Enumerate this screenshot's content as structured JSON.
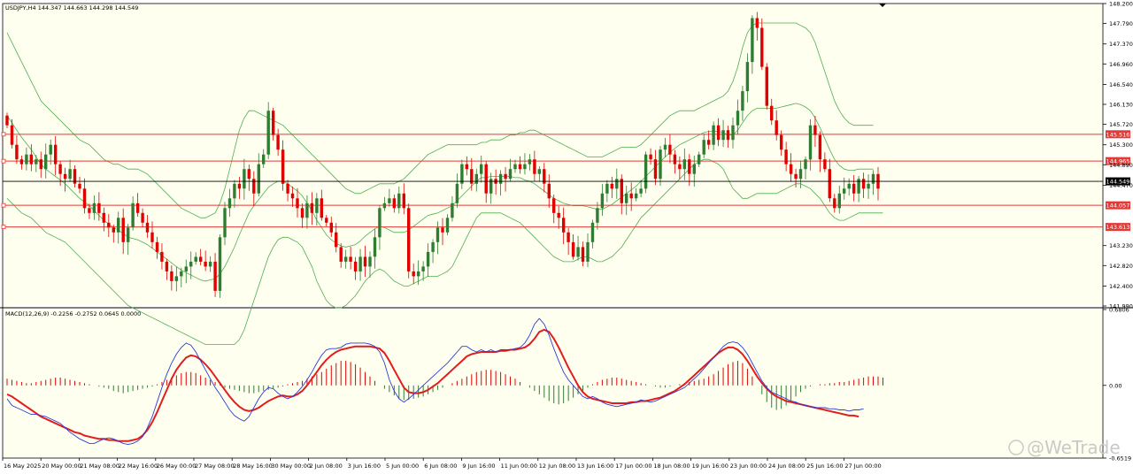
{
  "header": {
    "symbol_line": "USDJPY,H4  144.347 144.663 144.298 144.549",
    "macd_line": "MACD(12,26,9) -0.2256 -0.2752 0.0645 0.0000"
  },
  "watermark": "@WeTrade",
  "colors": {
    "background": "#fffff0",
    "bull": "#2e7d32",
    "bear": "#e00000",
    "bands": "#4caf50",
    "level": "#e53935",
    "macd": "#2d3bd6",
    "signal": "#e11d1d"
  },
  "chart_data": [
    {
      "type": "candlestick",
      "symbol": "USDJPY",
      "timeframe": "H4",
      "ylim": [
        141.99,
        148.2
      ],
      "y_ticks": [
        "148.200",
        "147.790",
        "147.370",
        "146.960",
        "146.540",
        "146.130",
        "145.720",
        "145.300",
        "144.890",
        "144.470",
        "142.820",
        "143.230",
        "142.400",
        "141.990"
      ],
      "x_ticks": [
        "16 May 2025",
        "20 May 00:00",
        "21 May 08:00",
        "22 May 16:00",
        "26 May 00:00",
        "27 May 08:00",
        "28 May 16:00",
        "30 May 00:00",
        "2 Jun 08:00",
        "3 Jun 16:00",
        "5 Jun 00:00",
        "6 Jun 08:00",
        "9 Jun 16:00",
        "11 Jun 00:00",
        "12 Jun 08:00",
        "13 Jun 16:00",
        "17 Jun 00:00",
        "18 Jun 08:00",
        "19 Jun 16:00",
        "23 Jun 00:00",
        "24 Jun 08:00",
        "25 Jun 16:00",
        "27 Jun 00:00"
      ],
      "current_price": "144.549",
      "levels": [
        {
          "label": "145.516",
          "value": 145.516
        },
        {
          "label": "144.965",
          "value": 144.965
        },
        {
          "label": "144.057",
          "value": 144.057
        },
        {
          "label": "143.613",
          "value": 143.613
        }
      ],
      "closes": [
        145.7,
        145.3,
        145.0,
        144.9,
        145.1,
        144.9,
        145.0,
        144.8,
        145.1,
        145.3,
        144.9,
        144.7,
        144.6,
        144.8,
        144.5,
        144.4,
        144.0,
        143.9,
        144.1,
        143.9,
        143.7,
        143.6,
        143.5,
        143.8,
        143.3,
        143.6,
        144.1,
        143.9,
        143.7,
        143.5,
        143.3,
        143.1,
        142.9,
        142.7,
        142.5,
        142.6,
        142.7,
        142.8,
        142.9,
        143.0,
        142.9,
        142.8,
        142.9,
        142.3,
        143.4,
        144.0,
        144.2,
        144.5,
        144.4,
        144.8,
        144.6,
        144.3,
        144.9,
        145.1,
        146.0,
        145.5,
        145.2,
        144.5,
        144.3,
        144.2,
        144.0,
        143.8,
        144.1,
        143.9,
        144.2,
        143.8,
        143.7,
        143.5,
        143.2,
        142.9,
        143.0,
        142.9,
        142.7,
        143.0,
        142.8,
        143.0,
        143.4,
        144.0,
        144.1,
        144.2,
        144.0,
        144.3,
        144.0,
        142.7,
        142.6,
        142.7,
        142.8,
        143.1,
        143.3,
        143.6,
        143.5,
        143.8,
        144.1,
        144.5,
        144.9,
        144.8,
        144.5,
        144.7,
        144.9,
        144.3,
        144.6,
        144.5,
        144.7,
        144.6,
        144.8,
        144.9,
        144.8,
        144.9,
        145.0,
        144.7,
        144.8,
        144.5,
        144.2,
        143.9,
        143.8,
        143.5,
        143.3,
        143.0,
        143.2,
        142.9,
        143.3,
        143.7,
        144.0,
        144.3,
        144.5,
        144.4,
        144.6,
        144.1,
        144.3,
        144.2,
        144.3,
        144.4,
        145.1,
        145.0,
        144.6,
        145.2,
        145.3,
        145.1,
        144.9,
        144.8,
        145.0,
        144.7,
        144.9,
        145.1,
        145.4,
        145.3,
        145.7,
        145.4,
        145.6,
        145.4,
        145.7,
        146.0,
        146.4,
        147.0,
        147.9,
        147.7,
        146.9,
        146.1,
        145.8,
        145.5,
        145.2,
        144.9,
        144.7,
        144.6,
        144.8,
        145.0,
        145.7,
        145.5,
        145.0,
        144.8,
        144.2,
        144.0,
        144.3,
        144.4,
        144.5,
        144.3,
        144.6,
        144.4,
        144.5,
        144.7,
        144.4
      ],
      "upper_band": [
        147.6,
        147.4,
        147.2,
        147.0,
        146.8,
        146.6,
        146.4,
        146.2,
        146.1,
        146.0,
        145.9,
        145.8,
        145.7,
        145.6,
        145.5,
        145.4,
        145.35,
        145.3,
        145.2,
        145.1,
        145.0,
        144.95,
        144.9,
        144.9,
        144.85,
        144.8,
        144.8,
        144.8,
        144.75,
        144.7,
        144.6,
        144.5,
        144.4,
        144.3,
        144.2,
        144.1,
        144.0,
        143.95,
        143.9,
        143.85,
        143.8,
        143.8,
        143.85,
        143.9,
        144.1,
        144.4,
        144.8,
        145.2,
        145.6,
        145.85,
        146.0,
        146.0,
        145.95,
        145.9,
        145.85,
        145.8,
        145.75,
        145.7,
        145.6,
        145.5,
        145.4,
        145.3,
        145.2,
        145.1,
        145.0,
        144.9,
        144.8,
        144.7,
        144.6,
        144.5,
        144.4,
        144.35,
        144.3,
        144.3,
        144.35,
        144.4,
        144.45,
        144.5,
        144.5,
        144.5,
        144.5,
        144.55,
        144.6,
        144.7,
        144.8,
        144.9,
        145.0,
        145.1,
        145.15,
        145.2,
        145.25,
        145.3,
        145.3,
        145.3,
        145.3,
        145.3,
        145.3,
        145.3,
        145.35,
        145.35,
        145.4,
        145.4,
        145.4,
        145.45,
        145.5,
        145.5,
        145.55,
        145.55,
        145.6,
        145.6,
        145.55,
        145.5,
        145.45,
        145.4,
        145.35,
        145.3,
        145.25,
        145.2,
        145.15,
        145.1,
        145.05,
        145.05,
        145.05,
        145.05,
        145.1,
        145.15,
        145.2,
        145.25,
        145.25,
        145.25,
        145.25,
        145.3,
        145.4,
        145.5,
        145.6,
        145.7,
        145.8,
        145.9,
        145.95,
        146.0,
        146.0,
        146.0,
        146.0,
        146.05,
        146.1,
        146.15,
        146.2,
        146.25,
        146.3,
        146.4,
        146.6,
        146.9,
        147.3,
        147.6,
        147.75,
        147.8,
        147.8,
        147.8,
        147.8,
        147.8,
        147.8,
        147.8,
        147.8,
        147.8,
        147.75,
        147.7,
        147.6,
        147.4,
        147.1,
        146.8,
        146.5,
        146.2,
        146.0,
        145.85,
        145.75,
        145.7,
        145.7,
        145.7,
        145.7,
        145.7
      ],
      "lower_band": [
        144.2,
        144.1,
        144.0,
        143.9,
        143.85,
        143.8,
        143.7,
        143.6,
        143.5,
        143.45,
        143.4,
        143.35,
        143.3,
        143.2,
        143.1,
        143.0,
        142.9,
        142.8,
        142.7,
        142.6,
        142.5,
        142.4,
        142.3,
        142.2,
        142.1,
        142.0,
        141.95,
        141.9,
        141.85,
        141.8,
        141.75,
        141.7,
        141.65,
        141.6,
        141.55,
        141.5,
        141.45,
        141.4,
        141.35,
        141.3,
        141.25,
        141.2,
        141.2,
        141.2,
        141.2,
        141.2,
        141.2,
        141.2,
        141.3,
        141.5,
        141.8,
        142.1,
        142.4,
        142.7,
        143.0,
        143.2,
        143.35,
        143.4,
        143.4,
        143.35,
        143.3,
        143.2,
        143.0,
        142.8,
        142.5,
        142.3,
        142.1,
        142.0,
        141.95,
        141.95,
        142.0,
        142.1,
        142.2,
        142.35,
        142.5,
        142.6,
        142.7,
        142.75,
        142.7,
        142.6,
        142.5,
        142.45,
        142.4,
        142.4,
        142.45,
        142.5,
        142.55,
        142.6,
        142.6,
        142.6,
        142.65,
        142.7,
        142.8,
        143.0,
        143.2,
        143.4,
        143.6,
        143.8,
        143.9,
        143.9,
        143.9,
        143.9,
        143.9,
        143.85,
        143.8,
        143.75,
        143.7,
        143.6,
        143.5,
        143.4,
        143.3,
        143.2,
        143.1,
        143.0,
        142.95,
        142.9,
        142.9,
        142.9,
        142.95,
        143.0,
        143.0,
        142.95,
        142.9,
        142.9,
        142.95,
        143.0,
        143.1,
        143.2,
        143.35,
        143.5,
        143.65,
        143.8,
        143.9,
        144.0,
        144.1,
        144.2,
        144.3,
        144.4,
        144.5,
        144.6,
        144.7,
        144.8,
        144.9,
        144.95,
        145.0,
        145.0,
        144.95,
        144.9,
        144.8,
        144.6,
        144.4,
        144.3,
        144.2,
        144.2,
        144.25,
        144.3,
        144.3,
        144.3,
        144.3,
        144.3,
        144.35,
        144.4,
        144.45,
        144.5,
        144.5,
        144.45,
        144.4,
        144.3,
        144.2,
        144.05,
        143.9,
        143.8,
        143.75,
        143.75,
        143.8,
        143.85,
        143.9,
        143.9,
        143.9,
        143.9,
        143.9,
        143.9
      ]
    },
    {
      "type": "bar",
      "name": "MACD",
      "ylim": [
        -0.6519,
        0.6806
      ],
      "y_ticks": [
        "0.6806",
        "0.00",
        "-0.6519"
      ],
      "histogram": [
        0.06,
        0.05,
        0.04,
        0.03,
        0.02,
        0.02,
        0.03,
        0.04,
        0.05,
        0.06,
        0.07,
        0.07,
        0.06,
        0.05,
        0.04,
        0.03,
        0.02,
        0.01,
        0.0,
        -0.01,
        -0.02,
        -0.03,
        -0.05,
        -0.06,
        -0.07,
        -0.06,
        -0.05,
        -0.04,
        -0.03,
        -0.02,
        -0.01,
        0.01,
        0.03,
        0.05,
        0.07,
        0.09,
        0.11,
        0.12,
        0.12,
        0.11,
        0.09,
        0.07,
        0.05,
        0.03,
        0.01,
        -0.02,
        -0.03,
        -0.04,
        -0.05,
        -0.06,
        -0.07,
        -0.07,
        -0.06,
        -0.05,
        -0.04,
        -0.03,
        -0.02,
        -0.01,
        0.01,
        0.02,
        0.03,
        0.04,
        0.06,
        0.08,
        0.1,
        0.12,
        0.15,
        0.18,
        0.2,
        0.22,
        0.22,
        0.21,
        0.19,
        0.16,
        0.12,
        0.08,
        0.04,
        0.0,
        -0.03,
        -0.06,
        -0.09,
        -0.12,
        -0.13,
        -0.13,
        -0.12,
        -0.11,
        -0.1,
        -0.08,
        -0.06,
        -0.04,
        -0.02,
        0.0,
        0.02,
        0.04,
        0.06,
        0.08,
        0.1,
        0.12,
        0.13,
        0.14,
        0.14,
        0.13,
        0.12,
        0.1,
        0.08,
        0.06,
        0.03,
        0.0,
        -0.02,
        -0.05,
        -0.08,
        -0.11,
        -0.14,
        -0.16,
        -0.17,
        -0.16,
        -0.14,
        -0.11,
        -0.08,
        -0.05,
        -0.02,
        0.01,
        0.03,
        0.05,
        0.06,
        0.07,
        0.07,
        0.06,
        0.05,
        0.04,
        0.03,
        0.02,
        0.01,
        0.0,
        -0.01,
        -0.02,
        -0.02,
        -0.01,
        0.0,
        0.01,
        0.02,
        0.03,
        0.04,
        0.05,
        0.06,
        0.08,
        0.1,
        0.13,
        0.16,
        0.19,
        0.21,
        0.22,
        0.2,
        0.15,
        0.08,
        0.0,
        -0.08,
        -0.15,
        -0.2,
        -0.22,
        -0.21,
        -0.18,
        -0.14,
        -0.1,
        -0.06,
        -0.03,
        -0.01,
        0.0,
        0.01,
        0.01,
        0.02,
        0.02,
        0.03,
        0.03,
        0.04,
        0.05,
        0.06,
        0.07,
        0.08,
        0.08,
        0.08,
        0.07
      ],
      "macd_line": [
        -0.12,
        -0.18,
        -0.2,
        -0.22,
        -0.24,
        -0.26,
        -0.26,
        -0.27,
        -0.28,
        -0.3,
        -0.32,
        -0.34,
        -0.38,
        -0.42,
        -0.45,
        -0.48,
        -0.5,
        -0.52,
        -0.52,
        -0.5,
        -0.48,
        -0.47,
        -0.48,
        -0.5,
        -0.52,
        -0.53,
        -0.52,
        -0.5,
        -0.46,
        -0.38,
        -0.28,
        -0.15,
        -0.02,
        0.1,
        0.2,
        0.28,
        0.34,
        0.38,
        0.36,
        0.3,
        0.22,
        0.14,
        0.06,
        -0.02,
        -0.08,
        -0.15,
        -0.22,
        -0.27,
        -0.3,
        -0.32,
        -0.28,
        -0.2,
        -0.12,
        -0.06,
        -0.02,
        -0.03,
        -0.07,
        -0.1,
        -0.12,
        -0.1,
        -0.06,
        -0.01,
        0.05,
        0.12,
        0.2,
        0.27,
        0.32,
        0.33,
        0.33,
        0.34,
        0.37,
        0.38,
        0.38,
        0.38,
        0.38,
        0.37,
        0.35,
        0.3,
        0.2,
        0.05,
        -0.05,
        -0.12,
        -0.15,
        -0.12,
        -0.08,
        -0.04,
        0.0,
        0.04,
        0.08,
        0.12,
        0.16,
        0.2,
        0.25,
        0.3,
        0.35,
        0.35,
        0.32,
        0.3,
        0.32,
        0.3,
        0.32,
        0.3,
        0.32,
        0.32,
        0.32,
        0.33,
        0.34,
        0.38,
        0.45,
        0.55,
        0.6,
        0.55,
        0.45,
        0.33,
        0.22,
        0.12,
        0.05,
        0.0,
        -0.05,
        -0.1,
        -0.12,
        -0.1,
        -0.12,
        -0.15,
        -0.17,
        -0.18,
        -0.19,
        -0.18,
        -0.17,
        -0.16,
        -0.15,
        -0.13,
        -0.14,
        -0.15,
        -0.14,
        -0.12,
        -0.1,
        -0.08,
        -0.06,
        -0.04,
        -0.02,
        0.02,
        0.06,
        0.1,
        0.15,
        0.2,
        0.25,
        0.3,
        0.35,
        0.38,
        0.39,
        0.38,
        0.34,
        0.28,
        0.2,
        0.12,
        0.04,
        -0.02,
        -0.06,
        -0.08,
        -0.1,
        -0.12,
        -0.14,
        -0.15,
        -0.17,
        -0.18,
        -0.19,
        -0.2,
        -0.2,
        -0.2,
        -0.21,
        -0.21,
        -0.22,
        -0.22,
        -0.23,
        -0.22,
        -0.22,
        -0.21
      ],
      "signal_line": [
        -0.08,
        -0.1,
        -0.13,
        -0.16,
        -0.19,
        -0.22,
        -0.25,
        -0.28,
        -0.3,
        -0.32,
        -0.34,
        -0.36,
        -0.38,
        -0.4,
        -0.42,
        -0.43,
        -0.45,
        -0.46,
        -0.47,
        -0.48,
        -0.48,
        -0.49,
        -0.49,
        -0.5,
        -0.5,
        -0.5,
        -0.49,
        -0.48,
        -0.45,
        -0.4,
        -0.33,
        -0.24,
        -0.14,
        -0.04,
        0.06,
        0.14,
        0.2,
        0.25,
        0.27,
        0.26,
        0.23,
        0.19,
        0.14,
        0.08,
        0.02,
        -0.04,
        -0.1,
        -0.15,
        -0.19,
        -0.22,
        -0.23,
        -0.22,
        -0.2,
        -0.17,
        -0.14,
        -0.12,
        -0.1,
        -0.09,
        -0.1,
        -0.1,
        -0.08,
        -0.05,
        0.0,
        0.06,
        0.12,
        0.18,
        0.23,
        0.27,
        0.3,
        0.32,
        0.33,
        0.34,
        0.35,
        0.35,
        0.35,
        0.35,
        0.34,
        0.33,
        0.29,
        0.22,
        0.14,
        0.06,
        -0.02,
        -0.06,
        -0.07,
        -0.07,
        -0.06,
        -0.04,
        -0.01,
        0.02,
        0.06,
        0.1,
        0.14,
        0.18,
        0.22,
        0.26,
        0.28,
        0.29,
        0.3,
        0.3,
        0.3,
        0.3,
        0.31,
        0.31,
        0.32,
        0.32,
        0.33,
        0.34,
        0.37,
        0.42,
        0.48,
        0.5,
        0.48,
        0.42,
        0.34,
        0.25,
        0.16,
        0.08,
        0.0,
        -0.06,
        -0.1,
        -0.12,
        -0.13,
        -0.14,
        -0.15,
        -0.16,
        -0.16,
        -0.16,
        -0.16,
        -0.15,
        -0.15,
        -0.14,
        -0.14,
        -0.13,
        -0.12,
        -0.11,
        -0.09,
        -0.07,
        -0.05,
        -0.02,
        0.01,
        0.05,
        0.09,
        0.13,
        0.17,
        0.21,
        0.25,
        0.29,
        0.32,
        0.34,
        0.34,
        0.32,
        0.28,
        0.22,
        0.15,
        0.08,
        0.02,
        -0.03,
        -0.07,
        -0.1,
        -0.12,
        -0.14,
        -0.15,
        -0.16,
        -0.17,
        -0.18,
        -0.19,
        -0.2,
        -0.21,
        -0.22,
        -0.23,
        -0.24,
        -0.25,
        -0.26,
        -0.27,
        -0.27,
        -0.28
      ]
    }
  ]
}
